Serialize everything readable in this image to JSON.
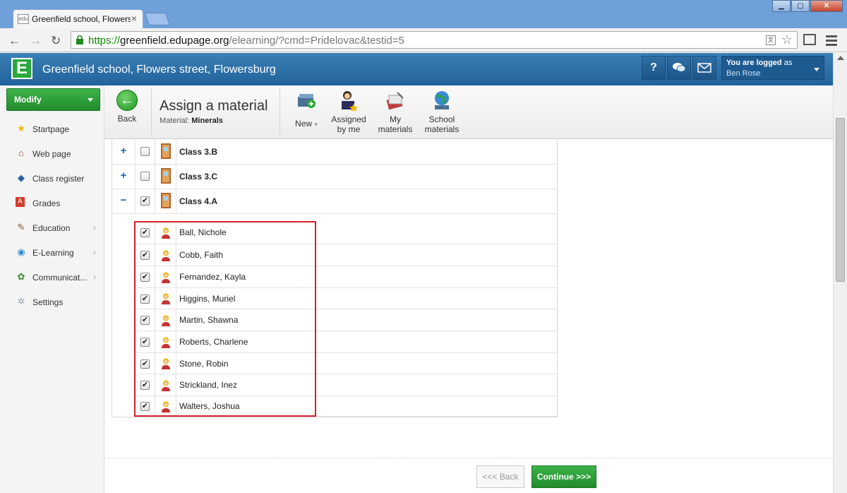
{
  "browser": {
    "tab_title": "Greenfield school, Flowers",
    "favicon_text": "edu",
    "url_scheme": "https://",
    "url_host": "greenfield.edupage.org",
    "url_path": "/elearning/?cmd=Pridelovac&testid=5"
  },
  "header": {
    "logo_letter": "E",
    "school_name": "Greenfield school, Flowers street, Flowersburg",
    "help_label": "?",
    "logged_label": "You are logged",
    "logged_as": " as",
    "user_name": "Ben Rose"
  },
  "sidebar": {
    "modify_label": "Modify",
    "items": [
      {
        "label": "Startpage",
        "icon": "star-icon",
        "has_submenu": false
      },
      {
        "label": "Web page",
        "icon": "house-icon",
        "has_submenu": false
      },
      {
        "label": "Class register",
        "icon": "book-icon",
        "has_submenu": false
      },
      {
        "label": "Grades",
        "icon": "grades-icon",
        "has_submenu": false
      },
      {
        "label": "Education",
        "icon": "education-icon",
        "has_submenu": true
      },
      {
        "label": "E-Learning",
        "icon": "elearning-icon",
        "has_submenu": true
      },
      {
        "label": "Communicat...",
        "icon": "communication-icon",
        "has_submenu": true
      },
      {
        "label": "Settings",
        "icon": "gear-icon",
        "has_submenu": false
      }
    ]
  },
  "toolbar": {
    "back_label": "Back",
    "title": "Assign a material",
    "material_label": "Material:",
    "material_name": "Minerals",
    "new_label": "New",
    "assigned_l1": "Assigned",
    "assigned_l2": "by me",
    "my_l1": "My",
    "my_l2": "materials",
    "school_l1": "School",
    "school_l2": "materials"
  },
  "classes": [
    {
      "name": "Class 3.B",
      "expanded": false,
      "checked": false
    },
    {
      "name": "Class 3.C",
      "expanded": false,
      "checked": false
    },
    {
      "name": "Class 4.A",
      "expanded": true,
      "checked": true
    }
  ],
  "students": [
    {
      "name": "Ball, Nichole",
      "checked": true
    },
    {
      "name": "Cobb, Faith",
      "checked": true
    },
    {
      "name": "Fernandez, Kayla",
      "checked": true
    },
    {
      "name": "Higgins, Muriel",
      "checked": true
    },
    {
      "name": "Martin, Shawna",
      "checked": true
    },
    {
      "name": "Roberts, Charlene",
      "checked": true
    },
    {
      "name": "Stone, Robin",
      "checked": true
    },
    {
      "name": "Strickland, Inez",
      "checked": true
    },
    {
      "name": "Walters, Joshua",
      "checked": true
    }
  ],
  "footer": {
    "back_label": "<<< Back",
    "continue_label": "Continue >>>"
  },
  "colors": {
    "header_blue": "#21629a",
    "green": "#2aa93b",
    "highlight_red": "#d6202a",
    "link_blue": "#1f66b0"
  }
}
